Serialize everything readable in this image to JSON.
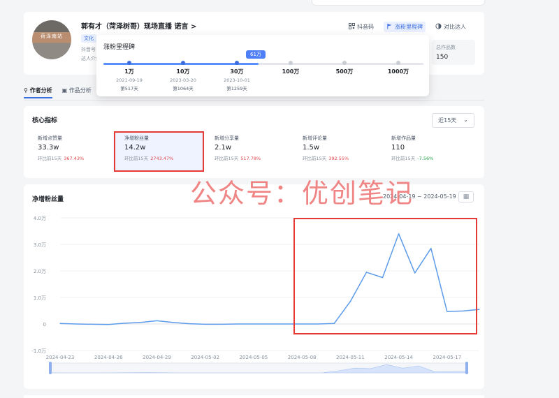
{
  "profile": {
    "name": "郭有才（菏泽树哥）现场直播 诺言 >",
    "tag": "文化",
    "meta_line1": "抖音号",
    "meta_line2": "达人介绍",
    "avatar_text": "荷泽南站",
    "actions": {
      "qr": "抖音码",
      "milestone": "涨粉里程碑",
      "compare": "对比达人"
    },
    "works_label": "总作品数",
    "works_value": "150"
  },
  "popup": {
    "title": "涨粉里程碑",
    "current_badge": "61万",
    "current_fraction": 0.485,
    "milestones": [
      {
        "value": "1万",
        "date": "2021-09-19",
        "days": "第517天",
        "reached": true
      },
      {
        "value": "10万",
        "date": "2023-03-20",
        "days": "第1064天",
        "reached": true
      },
      {
        "value": "30万",
        "date": "2023-10-01",
        "days": "第1259天",
        "reached": true
      },
      {
        "value": "100万",
        "date": "",
        "days": "",
        "reached": false
      },
      {
        "value": "500万",
        "date": "",
        "days": "",
        "reached": false
      },
      {
        "value": "1000万",
        "date": "",
        "days": "",
        "reached": false
      }
    ]
  },
  "tabs": [
    {
      "label": "作者分析",
      "active": true
    },
    {
      "label": "作品分析",
      "active": false
    }
  ],
  "core": {
    "title": "核心指标",
    "range": "近15天",
    "metrics": [
      {
        "label": "新增点赞量",
        "value": "33.3w",
        "compare_label": "环比前15天",
        "change": "367.43%",
        "direction": "up"
      },
      {
        "label": "净增粉丝量",
        "value": "14.2w",
        "compare_label": "环比前15天",
        "change": "2743.47%",
        "direction": "up"
      },
      {
        "label": "新增分享量",
        "value": "2.1w",
        "compare_label": "环比前15天",
        "change": "517.78%",
        "direction": "up"
      },
      {
        "label": "新增评论量",
        "value": "1.5w",
        "compare_label": "环比前15天",
        "change": "392.55%",
        "direction": "up"
      },
      {
        "label": "新增作品量",
        "value": "110",
        "compare_label": "环比前15天",
        "change": "-7.56%",
        "direction": "down"
      }
    ]
  },
  "chart_section": {
    "title": "净增粉丝量",
    "date_range": "2024-04-19 ~ 2024-05-19"
  },
  "watermark": "公众号：优创笔记",
  "colors": {
    "accent": "#3b6fe0",
    "line": "#5b9bea",
    "highlight": "#e53935",
    "up": "#e5484d",
    "down": "#27a349"
  },
  "chart_data": {
    "type": "line",
    "title": "净增粉丝量",
    "y_unit": "万",
    "ylim": [
      -1.0,
      4.0
    ],
    "y_ticks": [
      "-1.0万",
      "0",
      "1.0万",
      "2.0万",
      "3.0万",
      "4.0万"
    ],
    "y_tick_values": [
      -1,
      0,
      1,
      2,
      3,
      4
    ],
    "x_ticks": [
      "2024-04-23",
      "2024-04-26",
      "2024-04-29",
      "2024-05-02",
      "2024-05-05",
      "2024-05-08",
      "2024-05-11",
      "2024-05-14",
      "2024-05-17"
    ],
    "grid": true,
    "x": [
      "2024-04-23",
      "2024-04-24",
      "2024-04-25",
      "2024-04-26",
      "2024-04-27",
      "2024-04-28",
      "2024-04-29",
      "2024-04-30",
      "2024-05-01",
      "2024-05-02",
      "2024-05-03",
      "2024-05-04",
      "2024-05-05",
      "2024-05-06",
      "2024-05-07",
      "2024-05-08",
      "2024-05-09",
      "2024-05-10",
      "2024-05-11",
      "2024-05-12",
      "2024-05-13",
      "2024-05-14",
      "2024-05-15",
      "2024-05-16",
      "2024-05-17",
      "2024-05-18",
      "2024-05-19"
    ],
    "series": [
      {
        "values": [
          0.02,
          0.0,
          -0.01,
          -0.02,
          0.03,
          0.06,
          0.12,
          0.06,
          0.01,
          -0.01,
          -0.01,
          0.0,
          0.0,
          0.0,
          0.0,
          0.0,
          0.0,
          0.02,
          0.85,
          1.95,
          1.75,
          3.4,
          1.92,
          2.85,
          0.47,
          0.49,
          0.55
        ]
      }
    ]
  }
}
